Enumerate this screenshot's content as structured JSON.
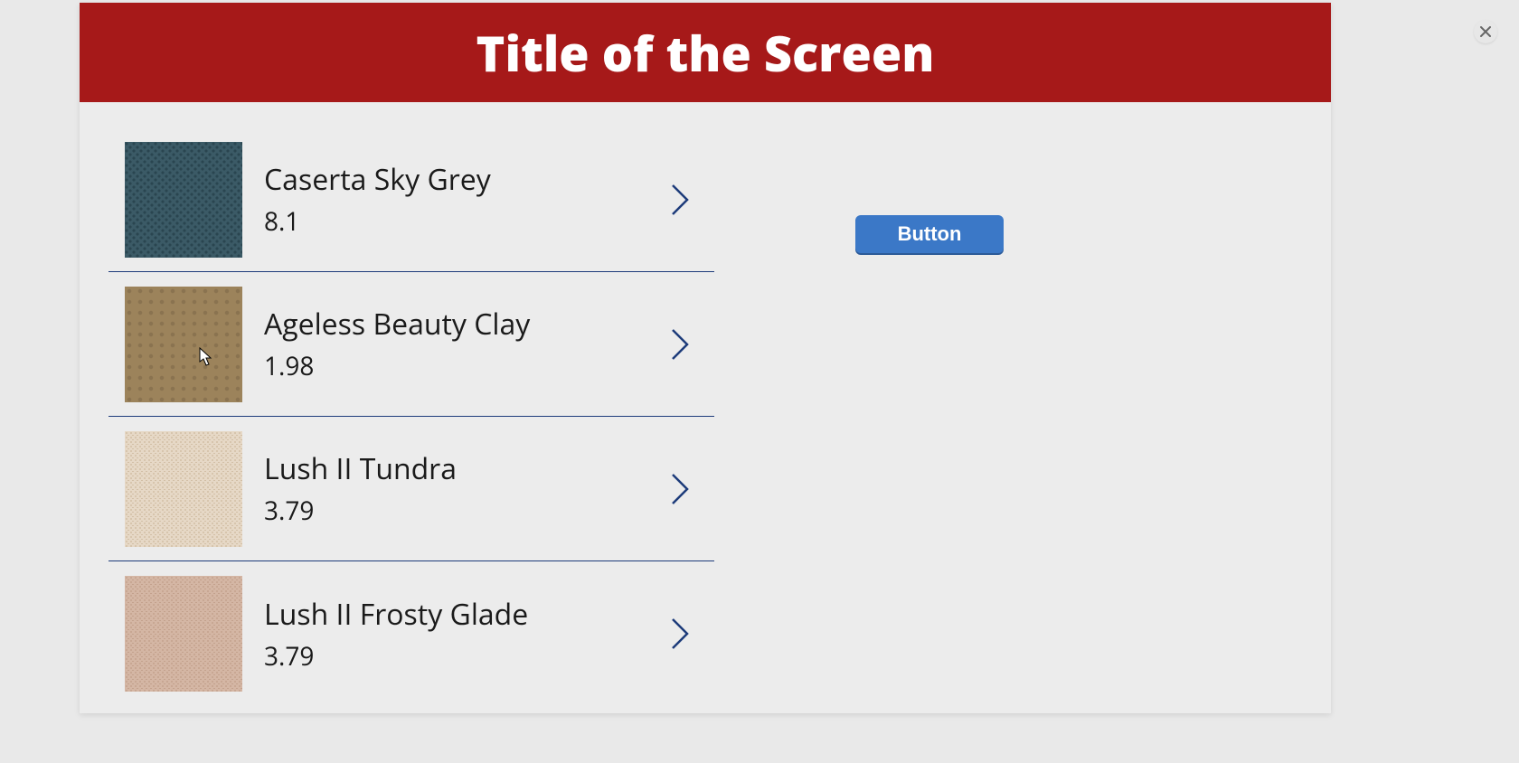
{
  "header": {
    "title": "Title of the Screen"
  },
  "list": [
    {
      "name": "Caserta Sky Grey",
      "value": "8.1",
      "swatch": "sky-grey"
    },
    {
      "name": "Ageless Beauty Clay",
      "value": "1.98",
      "swatch": "clay"
    },
    {
      "name": "Lush II Tundra",
      "value": "3.79",
      "swatch": "tundra"
    },
    {
      "name": "Lush II Frosty Glade",
      "value": "3.79",
      "swatch": "frosty"
    }
  ],
  "right_pane": {
    "button_label": "Button"
  },
  "colors": {
    "accent": "#a61919",
    "primary_button": "#3b78c7",
    "divider": "#1d3b7a"
  }
}
